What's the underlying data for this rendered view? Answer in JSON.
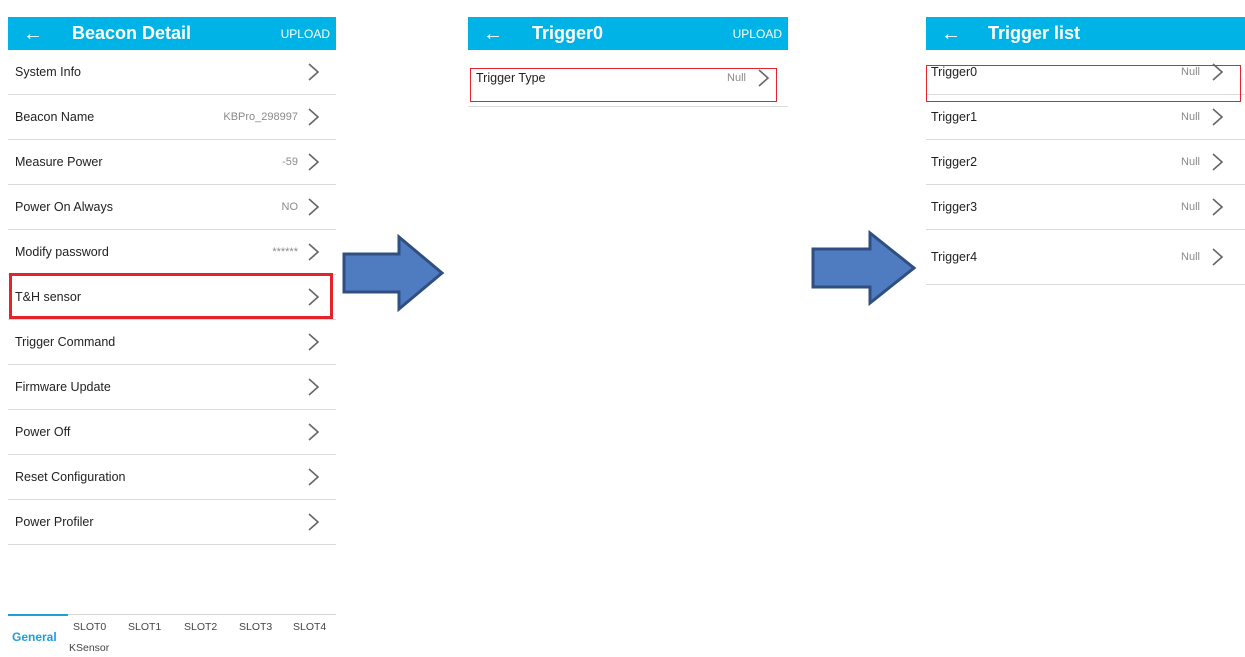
{
  "screen1": {
    "back_icon": "←",
    "title": "Beacon Detail",
    "upload": "UPLOAD",
    "rows": [
      {
        "label": "System Info",
        "value": ""
      },
      {
        "label": "Beacon Name",
        "value": "KBPro_298997"
      },
      {
        "label": "Measure Power",
        "value": "-59"
      },
      {
        "label": "Power On Always",
        "value": "NO"
      },
      {
        "label": "Modify password",
        "value": "******"
      },
      {
        "label": "T&H sensor",
        "value": ""
      },
      {
        "label": "Trigger Command",
        "value": ""
      },
      {
        "label": "Firmware Update",
        "value": ""
      },
      {
        "label": "Power Off",
        "value": ""
      },
      {
        "label": "Reset Configuration",
        "value": ""
      },
      {
        "label": "Power Profiler",
        "value": ""
      }
    ],
    "tabs": [
      "General",
      "SLOT0",
      "SLOT1",
      "SLOT2",
      "SLOT3",
      "SLOT4",
      "KSensor"
    ],
    "active_tab": "General"
  },
  "screen2": {
    "back_icon": "←",
    "title": "Trigger0",
    "upload": "UPLOAD",
    "rows": [
      {
        "label": "Trigger Type",
        "value": "Null"
      }
    ]
  },
  "screen3": {
    "back_icon": "←",
    "title": "Trigger list",
    "rows": [
      {
        "label": "Trigger0",
        "value": "Null"
      },
      {
        "label": "Trigger1",
        "value": "Null"
      },
      {
        "label": "Trigger2",
        "value": "Null"
      },
      {
        "label": "Trigger3",
        "value": "Null"
      },
      {
        "label": "Trigger4",
        "value": "Null"
      }
    ]
  },
  "colors": {
    "appbar": "#00b3e6",
    "highlight": "#e3242b",
    "arrow_fill": "#4f7cc0",
    "arrow_stroke": "#2f4f80",
    "tab_active": "#1e9fd8"
  },
  "icons": {
    "chevron": "chevron-right-icon",
    "back": "arrow-left-icon",
    "flow": "flow-arrow-right-icon"
  }
}
